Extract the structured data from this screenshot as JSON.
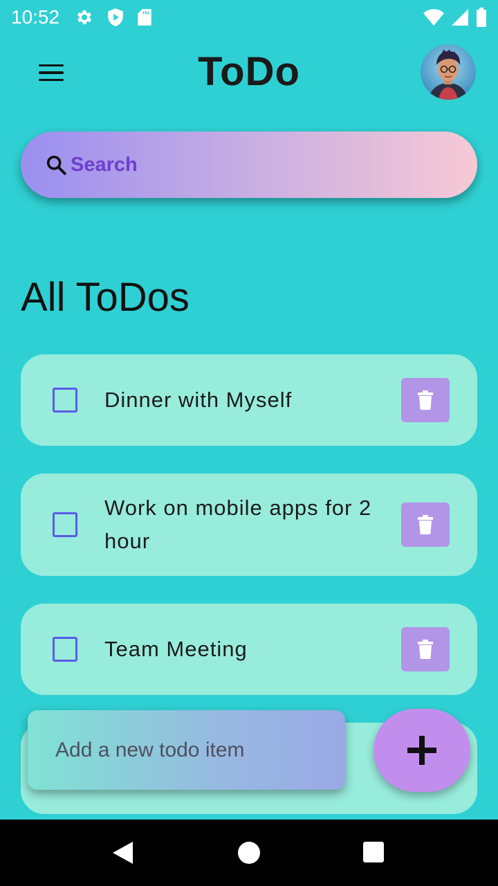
{
  "status_bar": {
    "time": "10:52",
    "left_icons": [
      "gear-icon",
      "shield-play-icon",
      "sd-card-icon"
    ],
    "right_icons": [
      "wifi-icon",
      "signal-icon",
      "battery-icon"
    ]
  },
  "app_bar": {
    "title": "ToDo",
    "menu_icon": "hamburger-menu-icon",
    "avatar": "user-avatar"
  },
  "search": {
    "placeholder": "Search",
    "value": ""
  },
  "section_title": "All ToDos",
  "todos": [
    {
      "text": "Dinner with Myself",
      "checked": false
    },
    {
      "text": "Work on mobile apps for 2 hour",
      "checked": false
    },
    {
      "text": "Team Meeting",
      "checked": false
    },
    {
      "text": "",
      "checked": false
    }
  ],
  "add_todo": {
    "placeholder": "Add a new todo item",
    "value": "",
    "button_icon": "plus-icon"
  },
  "colors": {
    "background": "#2fd0d3",
    "card": "#98ecdc",
    "delete_button": "#b295e6",
    "checkbox_border": "#5b5be8",
    "fab": "#c28eed",
    "search_text": "#6f3fcf"
  },
  "nav_bar": [
    "back-icon",
    "home-icon",
    "recents-icon"
  ]
}
